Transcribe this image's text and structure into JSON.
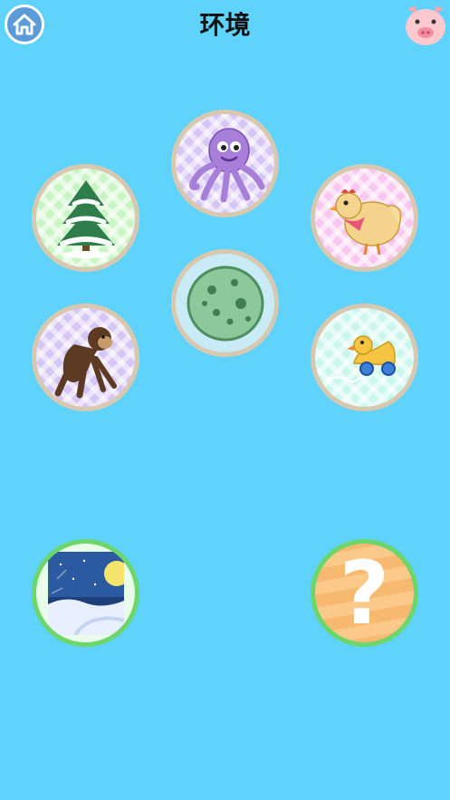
{
  "header": {
    "title": "环境",
    "home_icon": "home-icon",
    "pig_icon": "pig-face-icon"
  },
  "tiles": [
    {
      "name": "tile-octopus",
      "icon": "octopus-icon",
      "pattern": "purple"
    },
    {
      "name": "tile-snowy-tree",
      "icon": "snowy-pine-tree-icon",
      "pattern": "green"
    },
    {
      "name": "tile-hen",
      "icon": "hen-icon",
      "pattern": "pink"
    },
    {
      "name": "tile-cell",
      "icon": "green-cell-icon",
      "pattern": "light-blue"
    },
    {
      "name": "tile-monkey",
      "icon": "monkey-icon",
      "pattern": "purple"
    },
    {
      "name": "tile-toy-duck",
      "icon": "toy-duck-icon",
      "pattern": "mint"
    }
  ],
  "answer": {
    "icon": "winter-night-landscape-icon"
  },
  "mystery": {
    "label": "?"
  },
  "colors": {
    "background": "#5fd3fb",
    "tile_border": "#d8c8b0",
    "answer_border": "#6cd66a",
    "mystery_fill": "#f7b970"
  }
}
